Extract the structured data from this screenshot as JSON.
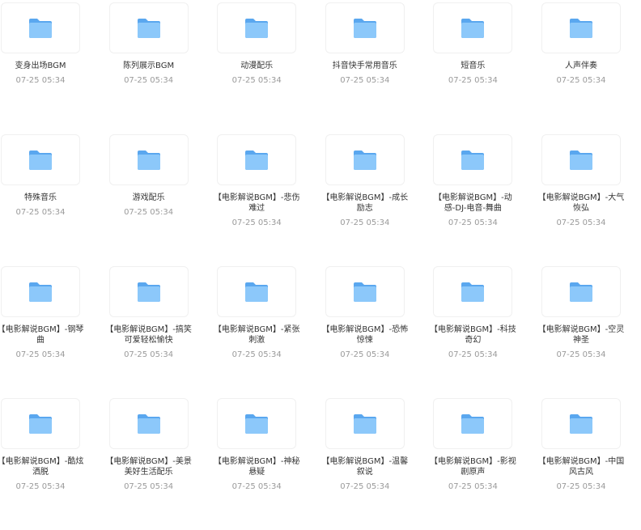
{
  "files": [
    {
      "name": "变身出场BGM",
      "date": "07-25 05:34"
    },
    {
      "name": "陈列展示BGM",
      "date": "07-25 05:34"
    },
    {
      "name": "动漫配乐",
      "date": "07-25 05:34"
    },
    {
      "name": "抖音快手常用音乐",
      "date": "07-25 05:34"
    },
    {
      "name": "短音乐",
      "date": "07-25 05:34"
    },
    {
      "name": "人声伴奏",
      "date": "07-25 05:34"
    },
    {
      "name": "特殊音乐",
      "date": "07-25 05:34"
    },
    {
      "name": "游戏配乐",
      "date": "07-25 05:34"
    },
    {
      "name": "【电影解说BGM】-悲伤难过",
      "date": "07-25 05:34"
    },
    {
      "name": "【电影解说BGM】-成长励志",
      "date": "07-25 05:34"
    },
    {
      "name": "【电影解说BGM】-动感-DJ-电音-舞曲",
      "date": "07-25 05:34"
    },
    {
      "name": "【电影解说BGM】-大气恢弘",
      "date": "07-25 05:34"
    },
    {
      "name": "【电影解说BGM】-钢琴曲",
      "date": "07-25 05:34"
    },
    {
      "name": "【电影解说BGM】-搞笑可爱轻松愉快",
      "date": "07-25 05:34"
    },
    {
      "name": "【电影解说BGM】-紧张刺激",
      "date": "07-25 05:34"
    },
    {
      "name": "【电影解说BGM】-恐怖惊悚",
      "date": "07-25 05:34"
    },
    {
      "name": "【电影解说BGM】-科技奇幻",
      "date": "07-25 05:34"
    },
    {
      "name": "【电影解说BGM】-空灵神圣",
      "date": "07-25 05:34"
    },
    {
      "name": "【电影解说BGM】-酷炫洒脱",
      "date": "07-25 05:34"
    },
    {
      "name": "【电影解说BGM】-美景美好生活配乐",
      "date": "07-25 05:34"
    },
    {
      "name": "【电影解说BGM】-神秘悬疑",
      "date": "07-25 05:34"
    },
    {
      "name": "【电影解说BGM】-温馨叙说",
      "date": "07-25 05:34"
    },
    {
      "name": "【电影解说BGM】-影视剧原声",
      "date": "07-25 05:34"
    },
    {
      "name": "【电影解说BGM】-中国风古风",
      "date": "07-25 05:34"
    }
  ],
  "icons": {
    "folder": "folder-icon"
  },
  "colors": {
    "folder_back": "#5aa7ef",
    "folder_front": "#8cc8fa"
  }
}
